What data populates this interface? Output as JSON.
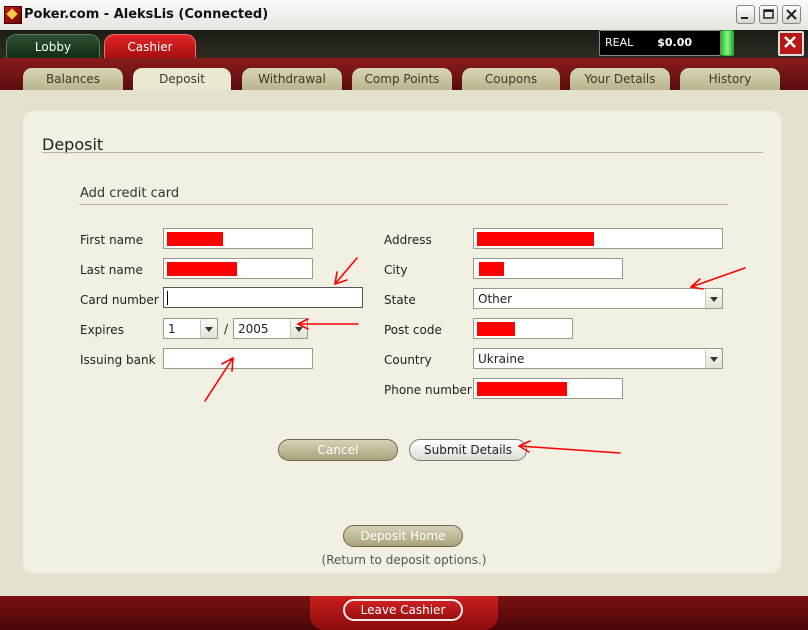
{
  "window": {
    "title": "Poker.com - AleksLis (Connected)"
  },
  "top_tabs": [
    {
      "label": "Lobby"
    },
    {
      "label": "Cashier"
    }
  ],
  "balance": {
    "mode": "REAL",
    "amount": "$0.00"
  },
  "sub_tabs": [
    {
      "label": "Balances"
    },
    {
      "label": "Deposit"
    },
    {
      "label": "Withdrawal"
    },
    {
      "label": "Comp Points"
    },
    {
      "label": "Coupons"
    },
    {
      "label": "Your Details"
    },
    {
      "label": "History"
    }
  ],
  "active_sub_tab": "Deposit",
  "page": {
    "title": "Deposit",
    "section_title": "Add credit card"
  },
  "form": {
    "first_name_label": "First name",
    "last_name_label": "Last name",
    "card_number_label": "Card number",
    "expires_label": "Expires",
    "expires_month": "1",
    "expires_separator": "/",
    "expires_year": "2005",
    "issuing_bank_label": "Issuing bank",
    "address_label": "Address",
    "city_label": "City",
    "state_label": "State",
    "state_value": "Other",
    "post_code_label": "Post code",
    "country_label": "Country",
    "country_value": "Ukraine",
    "phone_label": "Phone number"
  },
  "buttons": {
    "cancel": "Cancel",
    "submit": "Submit Details",
    "deposit_home": "Deposit Home",
    "leave_cashier": "Leave Cashier"
  },
  "return_note": "(Return to deposit options.)",
  "colors": {
    "redaction": "#ff0000",
    "annotation_arrow": "#ff0000",
    "cashier_tab": "#c81717",
    "panel_bg": "#f2f0e2"
  }
}
